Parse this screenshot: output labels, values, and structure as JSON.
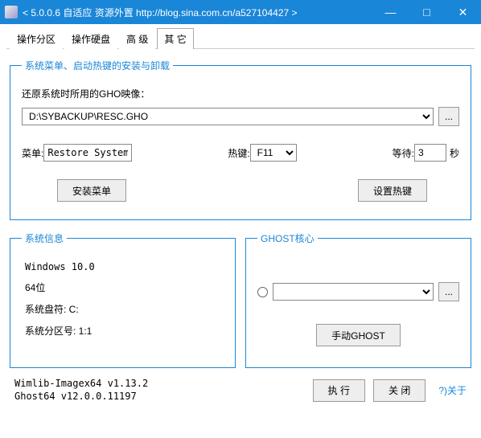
{
  "titlebar": {
    "title": "< 5.0.0.6 自适应 资源外置 http://blog.sina.com.cn/a527104427 >",
    "minimize": "—",
    "maximize": "□",
    "close": "✕"
  },
  "tabs": [
    "操作分区",
    "操作硬盘",
    "高  级",
    "其  它"
  ],
  "active_tab_index": 3,
  "section_hotkey": {
    "legend": "系统菜单、启动热键的安装与卸载",
    "gho_label": "还原系统时所用的GHO映像：",
    "gho_path": "D:\\SYBACKUP\\RESC.GHO",
    "browse": "...",
    "menu_label": "菜单:",
    "menu_value": "Restore System",
    "hotkey_label": "热键:",
    "hotkey_value": "F11",
    "wait_label": "等待:",
    "wait_value": "3",
    "wait_unit": "秒",
    "install_menu_btn": "安装菜单",
    "set_hotkey_btn": "设置热键"
  },
  "section_sysinfo": {
    "legend": "系统信息",
    "os": "Windows 10.0",
    "bits": "64位",
    "drive": "系统盘符: C:",
    "partition": "系统分区号: 1:1"
  },
  "section_ghost": {
    "legend": "GHOST核心",
    "browse": "...",
    "manual_btn": "手动GHOST"
  },
  "footer": {
    "line1": "Wimlib-Imagex64 v1.13.2",
    "line2": "Ghost64 v12.0.0.11197",
    "run": "执  行",
    "close": "关  闭",
    "about": "?)关于"
  }
}
